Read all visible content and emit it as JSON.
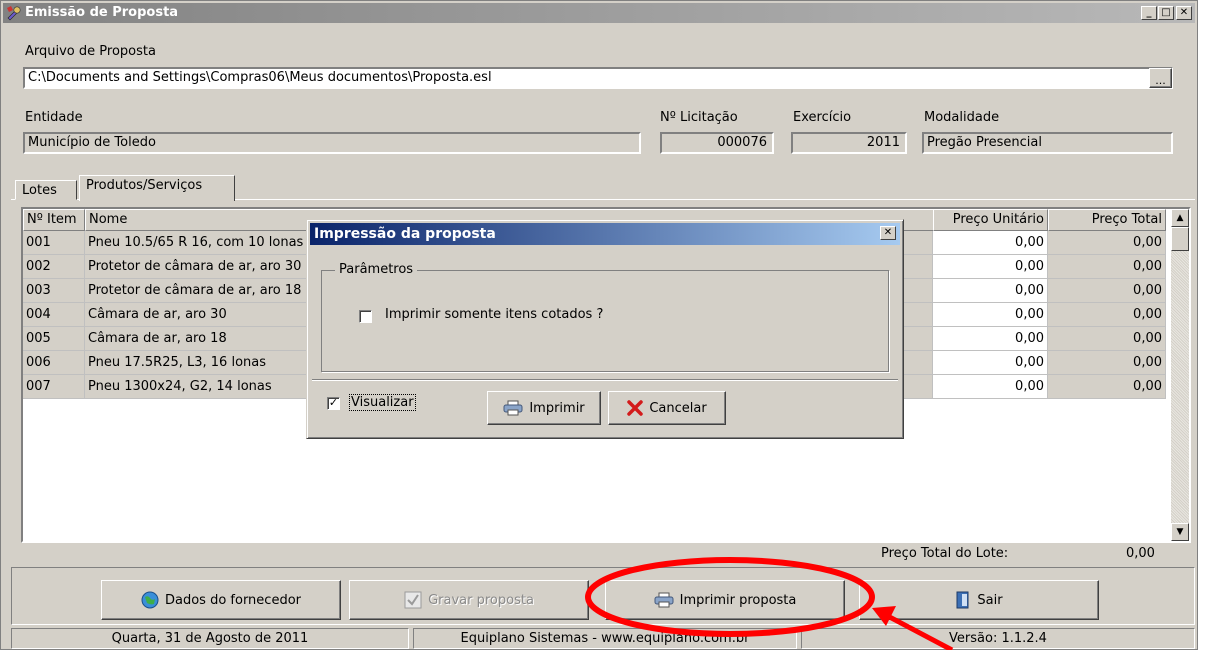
{
  "window": {
    "title": "Emissão de Proposta"
  },
  "file": {
    "label": "Arquivo de Proposta",
    "path": "C:\\Documents and Settings\\Compras06\\Meus documentos\\Proposta.esl",
    "browse_label": "..."
  },
  "info": {
    "entidade_label": "Entidade",
    "entidade": "Município de Toledo",
    "licitacao_label": "Nº Licitação",
    "licitacao": "000076",
    "exercicio_label": "Exercício",
    "exercicio": "2011",
    "modalidade_label": "Modalidade",
    "modalidade": "Pregão Presencial"
  },
  "tabs": [
    {
      "label": "Lotes"
    },
    {
      "label": "Produtos/Serviços"
    }
  ],
  "grid": {
    "headers": {
      "item": "Nº Item",
      "nome": "Nome",
      "preco_unit": "Preço Unitário",
      "preco_total": "Preço Total"
    },
    "rows": [
      {
        "item": "001",
        "nome": "Pneu 10.5/65 R 16, com 10 lonas",
        "unit": "0,00",
        "total": "0,00"
      },
      {
        "item": "002",
        "nome": "Protetor de câmara de ar, aro 30",
        "unit": "0,00",
        "total": "0,00"
      },
      {
        "item": "003",
        "nome": "Protetor de câmara de ar, aro 18",
        "unit": "0,00",
        "total": "0,00"
      },
      {
        "item": "004",
        "nome": "Câmara de ar, aro 30",
        "unit": "0,00",
        "total": "0,00"
      },
      {
        "item": "005",
        "nome": "Câmara de ar, aro 18",
        "unit": "0,00",
        "total": "0,00"
      },
      {
        "item": "006",
        "nome": "Pneu 17.5R25, L3, 16 lonas",
        "unit": "0,00",
        "total": "0,00"
      },
      {
        "item": "007",
        "nome": "Pneu 1300x24, G2, 14 lonas",
        "unit": "0,00",
        "total": "0,00"
      }
    ]
  },
  "lote_total": {
    "label": "Preço Total do Lote:",
    "value": "0,00"
  },
  "buttons": {
    "dados": "Dados do fornecedor",
    "gravar": "Gravar proposta",
    "imprimir": "Imprimir proposta",
    "sair": "Sair"
  },
  "status": {
    "date": "Quarta, 31 de Agosto de 2011",
    "company": "Equiplano Sistemas - www.equiplano.com.br",
    "version": "Versão: 1.1.2.4"
  },
  "dialog": {
    "title": "Impressão da proposta",
    "group_label": "Parâmetros",
    "checkbox_label": "Imprimir somente itens cotados ?",
    "checkbox_checked": false,
    "visualizar_label": "Visualizar",
    "visualizar_checked": true,
    "print_label": "Imprimir",
    "cancel_label": "Cancelar"
  },
  "colors": {
    "annotation": "#ff0000",
    "dialog_title": "#0a246a"
  }
}
